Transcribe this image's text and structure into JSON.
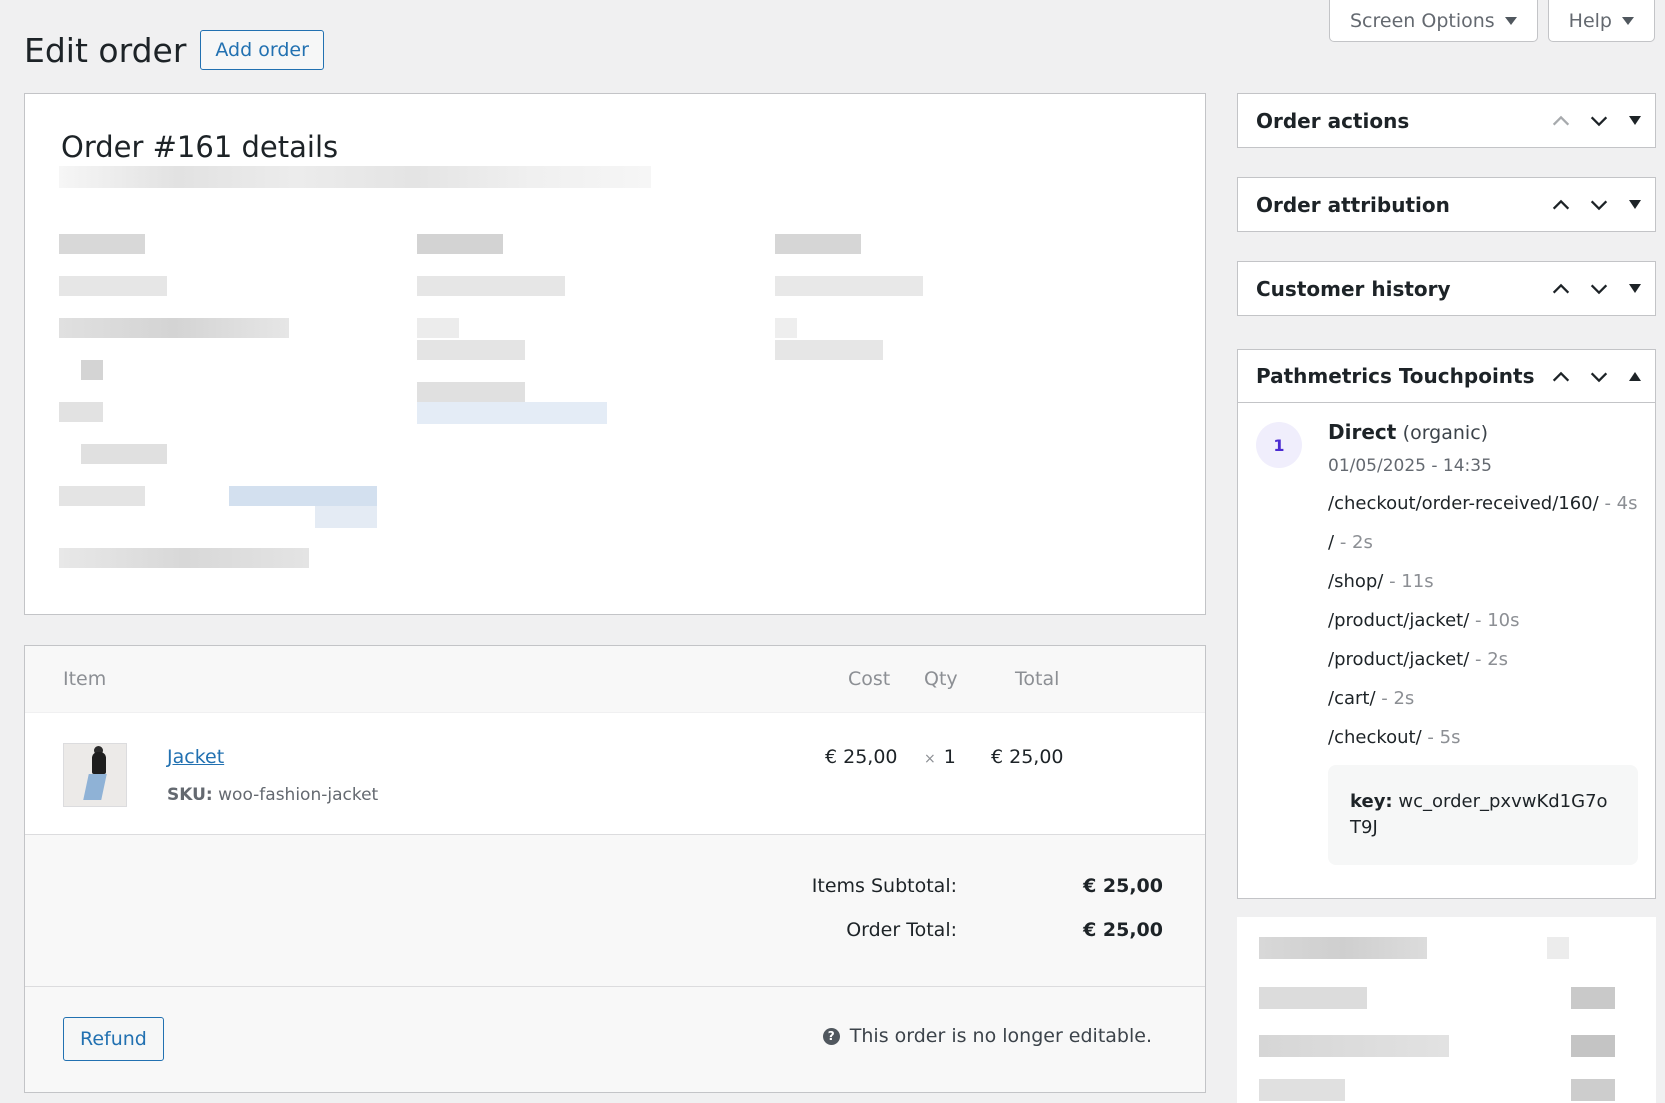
{
  "screen_meta": {
    "screen_options": "Screen Options",
    "help": "Help"
  },
  "header": {
    "title": "Edit order",
    "add_button": "Add order"
  },
  "order_details": {
    "title": "Order #161 details"
  },
  "items": {
    "columns": {
      "item": "Item",
      "cost": "Cost",
      "qty": "Qty",
      "total": "Total"
    },
    "rows": [
      {
        "name": "Jacket",
        "sku_label": "SKU:",
        "sku": "woo-fashion-jacket",
        "cost": "€ 25,00",
        "qty_prefix": "×",
        "qty": "1",
        "total": "€ 25,00"
      }
    ],
    "totals": {
      "subtotal_label": "Items Subtotal:",
      "subtotal_value": "€ 25,00",
      "order_total_label": "Order Total:",
      "order_total_value": "€ 25,00"
    },
    "refund_button": "Refund",
    "not_editable_note": "This order is no longer editable."
  },
  "sidebar": {
    "boxes": [
      {
        "title": "Order actions"
      },
      {
        "title": "Order attribution"
      },
      {
        "title": "Customer history"
      },
      {
        "title": "Pathmetrics Touchpoints"
      }
    ],
    "touchpoint": {
      "step": "1",
      "channel": "Direct",
      "channel_type": "(organic)",
      "datetime": "01/05/2025 - 14:35",
      "pages": [
        {
          "path": "/checkout/order-received/160/",
          "duration": "- 4s"
        },
        {
          "path": "/",
          "duration": "- 2s"
        },
        {
          "path": "/shop/",
          "duration": "- 11s"
        },
        {
          "path": "/product/jacket/",
          "duration": "- 10s"
        },
        {
          "path": "/product/jacket/",
          "duration": "- 2s"
        },
        {
          "path": "/cart/",
          "duration": "- 2s"
        },
        {
          "path": "/checkout/",
          "duration": "- 5s"
        }
      ],
      "key_label": "key:",
      "key_value": "wc_order_pxvwKd1G7oT9J"
    }
  },
  "colors": {
    "accent": "#2271b1",
    "background": "#f0f0f1",
    "step_badge_bg": "#f0eefc",
    "step_badge_text": "#4b2bd1"
  }
}
